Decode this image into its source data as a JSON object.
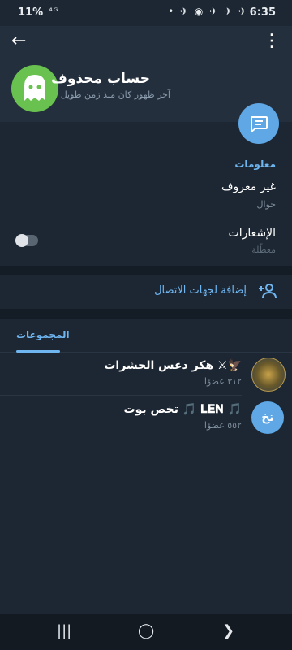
{
  "status": {
    "battery": "11%",
    "signal": "⁴ᴳ",
    "right_icons": "• ✈ ◉ ✈ ✈ ✈",
    "time": "6:35"
  },
  "profile": {
    "name": "حساب محذوف",
    "last_seen": "آخر ظهور كان منذ زمن طويل",
    "avatar_color": "#69c14f"
  },
  "info": {
    "title": "معلومات",
    "phone": "غير معروف",
    "phone_label": "جوال",
    "notifications_label": "الإشعارات",
    "notifications_status": "معطّلة"
  },
  "actions": {
    "add_contact": "إضافة لجهات الاتصال"
  },
  "tabs": [
    {
      "label": "المجموعات"
    }
  ],
  "groups": [
    {
      "name": "هكر دعس الحشرات ⚔🦅",
      "members": "٣١٢ عضوًا"
    },
    {
      "name": "تخص بوت 🎵 𝐋𝐄𝐍 🎵",
      "members": "٥٥٢ عضوًا",
      "initials": "تخ"
    }
  ],
  "colors": {
    "accent": "#6fb6f1",
    "background": "#1d2733",
    "header": "#242f3d"
  }
}
